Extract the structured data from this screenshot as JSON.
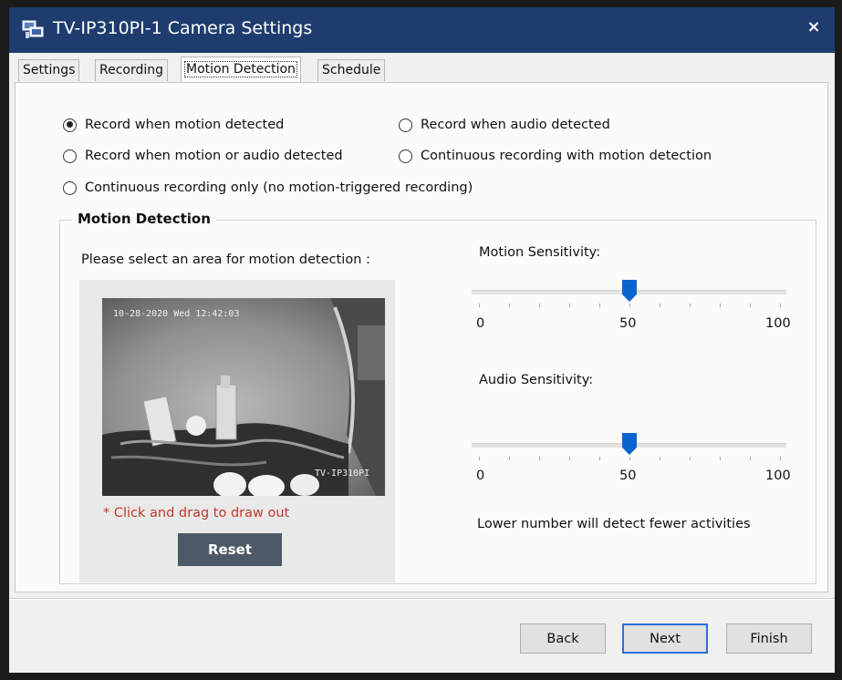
{
  "window": {
    "title": "TV-IP310PI-1 Camera Settings",
    "icon": "app-camera-icon",
    "close_symbol": "×",
    "title_color": "#1f3c6e"
  },
  "tabs": [
    {
      "label": "Settings",
      "active": false
    },
    {
      "label": "Recording",
      "active": false
    },
    {
      "label": "Motion Detection",
      "active": true
    },
    {
      "label": "Schedule",
      "active": false
    }
  ],
  "recording_modes": [
    {
      "label": "Record when motion detected",
      "checked": true
    },
    {
      "label": "Record when audio detected",
      "checked": false
    },
    {
      "label": "Record when motion or audio detected",
      "checked": false
    },
    {
      "label": "Continuous recording with motion detection",
      "checked": false
    },
    {
      "label": "Continuous recording only (no motion-triggered recording)",
      "checked": false
    }
  ],
  "motion_detection": {
    "group_title": "Motion Detection",
    "area_prompt": "Please select an area for motion detection :",
    "camera_overlay": {
      "timestamp": "10-28-2020 Wed 12:42:03",
      "camera_name": "TV-IP310PI"
    },
    "hint": "* Click and drag to draw out",
    "reset_label": "Reset",
    "hint_color": "#c0392b"
  },
  "motion_sensitivity": {
    "label": "Motion Sensitivity:",
    "min_label": "0",
    "mid_label": "50",
    "max_label": "100",
    "value": 50,
    "min": 0,
    "max": 100
  },
  "audio_sensitivity": {
    "label": "Audio Sensitivity:",
    "min_label": "0",
    "mid_label": "50",
    "max_label": "100",
    "value": 50,
    "min": 0,
    "max": 100
  },
  "sensitivity_note": "Lower number will detect fewer activities",
  "footer": {
    "back_label": "Back",
    "next_label": "Next",
    "finish_label": "Finish",
    "default_button": "Next",
    "accent_color": "#2d6fd4"
  },
  "slider_color": "#0a64d0"
}
